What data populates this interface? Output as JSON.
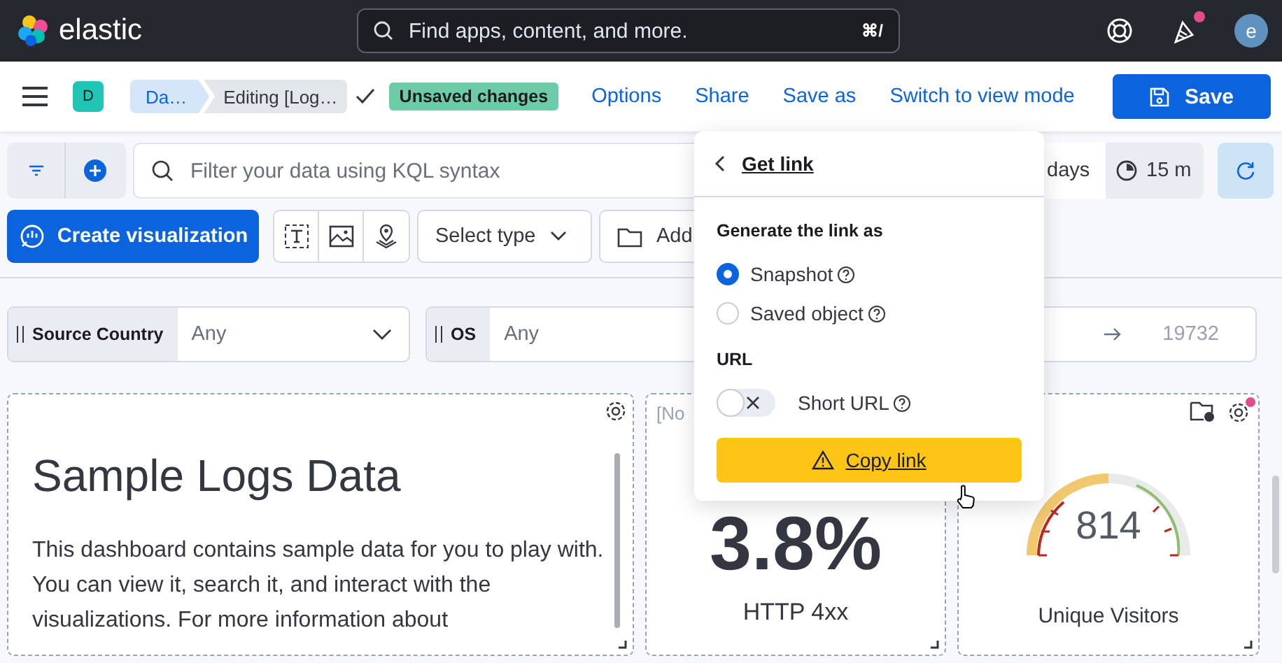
{
  "header": {
    "logo_text": "elastic",
    "search": {
      "placeholder": "Find apps, content, and more.",
      "shortcut": "⌘/"
    },
    "news_unread": true,
    "avatar": "e"
  },
  "toolbar": {
    "space": "D",
    "breadcrumbs": [
      {
        "label": "Da…",
        "selected": false
      },
      {
        "label": "Editing [Log…",
        "selected": true
      }
    ],
    "badge": "Unsaved changes",
    "links": [
      "Options",
      "Share",
      "Save as",
      "Switch to view mode"
    ],
    "save": "Save"
  },
  "query_bar": {
    "placeholder": "Filter your data using KQL syntax",
    "date": "days",
    "refresh_interval": "15 m"
  },
  "actions": {
    "create": "Create visualization",
    "select_type": "Select type",
    "add": "Add"
  },
  "controls": [
    {
      "kind": "select",
      "label": "Source Country",
      "value": "Any"
    },
    {
      "kind": "select",
      "label": "OS",
      "value": "Any"
    },
    {
      "kind": "range",
      "max": "19732"
    }
  ],
  "panels": [
    {
      "kind": "markdown",
      "heading": "Sample Logs Data",
      "body": "This dashboard contains sample data for you to play with. You can view it, search it, and interact with the visualizations. For more information about"
    },
    {
      "kind": "metric",
      "title": "[No",
      "value": "3.8%",
      "label": "HTTP 4xx"
    },
    {
      "kind": "gauge",
      "value": "814",
      "label": "Unique Visitors",
      "unread": true
    }
  ],
  "popover": {
    "title": "Get link",
    "generate_label": "Generate the link as",
    "options": [
      {
        "label": "Snapshot",
        "selected": true
      },
      {
        "label": "Saved object",
        "selected": false
      }
    ],
    "url_label": "URL",
    "short_url": {
      "label": "Short URL",
      "on": false
    },
    "copy_button": "Copy link"
  }
}
